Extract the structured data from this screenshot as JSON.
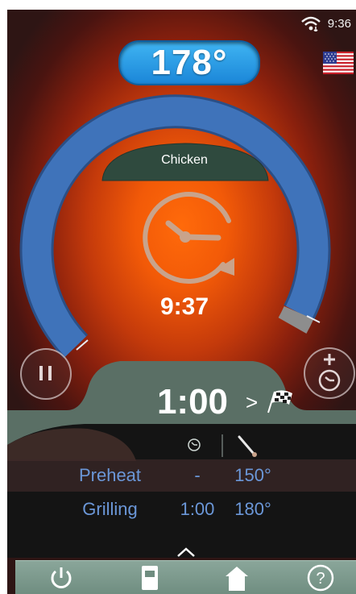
{
  "status": {
    "time": "9:36"
  },
  "header": {
    "temperature": "178°"
  },
  "dial": {
    "food": "Chicken",
    "remaining_time": "9:37"
  },
  "controls": {
    "timer": "1:00"
  },
  "program": {
    "rows": [
      {
        "name": "Preheat",
        "time": "-",
        "temp": "150°"
      },
      {
        "name": "Grilling",
        "time": "1:00",
        "temp": "180°"
      }
    ]
  },
  "colors": {
    "arc_blue": "#3b6fb8",
    "pill_blue": "#2a9be6",
    "panel": "#5b6f66",
    "row_text": "#6b97d8"
  },
  "icons": {
    "wifi": "wifi-icon",
    "flag": "us-flag-icon",
    "clock": "clock-icon",
    "pause": "pause-icon",
    "add_timer": "add-timer-icon",
    "finish": "finish-flag-icon",
    "thermometer": "probe-icon",
    "power": "power-icon",
    "book": "recipe-book-icon",
    "home": "home-icon",
    "help": "help-icon"
  }
}
